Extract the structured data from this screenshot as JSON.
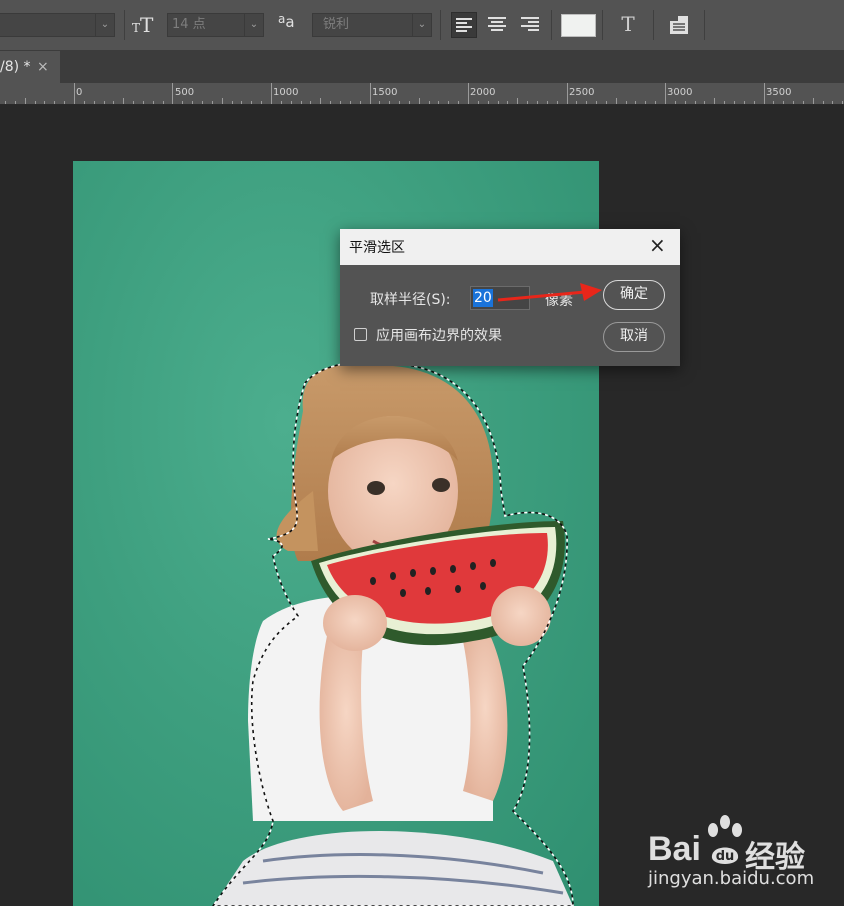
{
  "options_bar": {
    "font_size_value": "14 点",
    "aa_icon_label": "a",
    "aa_icon_sub": "a",
    "antialias_value": "锐利",
    "text_tool_glyph": "T",
    "warp_glyph": "T",
    "icons": [
      "text-orientation-icon",
      "anti-alias-icon",
      "align-left-icon",
      "align-center-icon",
      "align-right-icon",
      "color-swatch",
      "warp-text-icon",
      "character-panel-icon"
    ],
    "text_color": "#f0f2f0"
  },
  "tab": {
    "label": "/8) *",
    "close": "×"
  },
  "ruler": {
    "labels": [
      "0",
      "500",
      "1000",
      "1500",
      "2000",
      "2500",
      "3000",
      "3500"
    ]
  },
  "dialog": {
    "title": "平滑选区",
    "close": "×",
    "radius_label": "取样半径(S):",
    "radius_value": "20",
    "unit": "像素",
    "checkbox_label": "应用画布边界的效果",
    "checkbox_checked": false,
    "ok_label": "确定",
    "cancel_label": "取消"
  },
  "colors": {
    "accent": "#1a73d9",
    "canvas_bg": "#3e9f7f",
    "arrow": "#e8261a"
  },
  "watermark": {
    "brand_left": "Bai",
    "brand_right": "经验",
    "url": "jingyan.baidu.com"
  }
}
